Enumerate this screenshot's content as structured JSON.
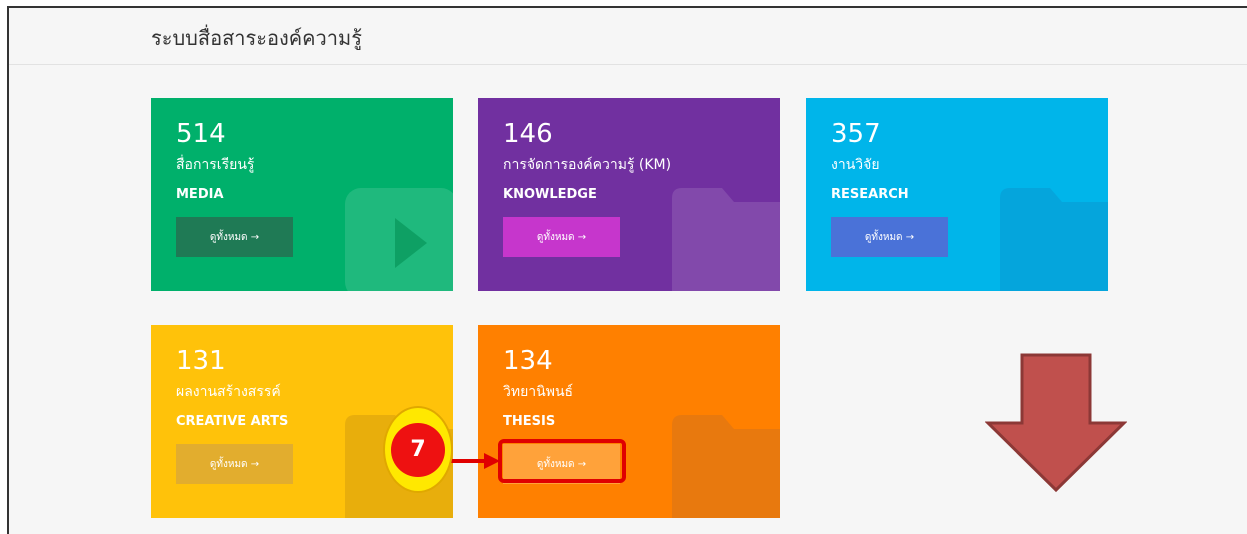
{
  "header": {
    "title": "ระบบสื่อสาระองค์ความรู้"
  },
  "cards": [
    {
      "count": "514",
      "th": "สื่อการเรียนรู้",
      "en": "MEDIA",
      "button": "ดูทั้งหมด →",
      "bg": "#00b06b",
      "btn_bg": "#1f7a55",
      "icon": "play-icon"
    },
    {
      "count": "146",
      "th": "การจัดการองค์ความรู้ (KM)",
      "en": "KNOWLEDGE",
      "button": "ดูทั้งหมด →",
      "bg": "#7130a0",
      "btn_bg": "#c636cc",
      "icon": "folder-icon"
    },
    {
      "count": "357",
      "th": "งานวิจัย",
      "en": "RESEARCH",
      "button": "ดูทั้งหมด →",
      "bg": "#00b5ea",
      "btn_bg": "#4a72d8",
      "icon": "folder-icon"
    },
    {
      "count": "131",
      "th": "ผลงานสร้างสรรค์",
      "en": "CREATIVE ARTS",
      "button": "ดูทั้งหมด →",
      "bg": "#ffc20a",
      "btn_bg": "#e2ad2e",
      "icon": "folder-icon"
    },
    {
      "count": "134",
      "th": "วิทยานิพนธ์",
      "en": "THESIS",
      "button": "ดูทั้งหมด →",
      "bg": "#ff8000",
      "btn_bg": "#ffa23a",
      "icon": "folder-icon"
    }
  ],
  "annotation": {
    "step": "7",
    "step_color": "#ee1111",
    "highlight_color": "#e00000",
    "arrow_color": "#c0504d"
  }
}
